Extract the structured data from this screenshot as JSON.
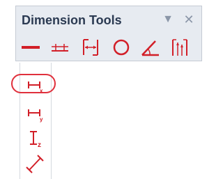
{
  "toolbar": {
    "title": "Dimension Tools",
    "dropdown_icon": "triangle-down-icon",
    "close_icon": "close-icon",
    "tools": [
      {
        "name": "line-tool",
        "icon": "horizontal-line-icon"
      },
      {
        "name": "parallel-dimension-tool",
        "icon": "parallel-dimension-icon"
      },
      {
        "name": "box-dimension-tool",
        "icon": "box-dimension-icon"
      },
      {
        "name": "circle-tool",
        "icon": "circle-icon"
      },
      {
        "name": "angle-tool",
        "icon": "angle-icon"
      },
      {
        "name": "multi-dimension-tool",
        "icon": "multi-dimension-icon"
      }
    ]
  },
  "flyout": {
    "items": [
      {
        "name": "horizontal-dimension-x",
        "icon": "dimension-x-icon",
        "selected": true
      },
      {
        "name": "horizontal-dimension-y",
        "icon": "dimension-y-icon",
        "selected": false
      },
      {
        "name": "vertical-dimension-z",
        "icon": "dimension-z-icon",
        "selected": false
      },
      {
        "name": "diagonal-dimension",
        "icon": "diagonal-dimension-icon",
        "selected": false
      }
    ]
  },
  "colors": {
    "accent": "#d21f28",
    "toolbar_bg": "#e7ebf1",
    "title_text": "#2b3a52",
    "highlight": "#e0303c"
  }
}
